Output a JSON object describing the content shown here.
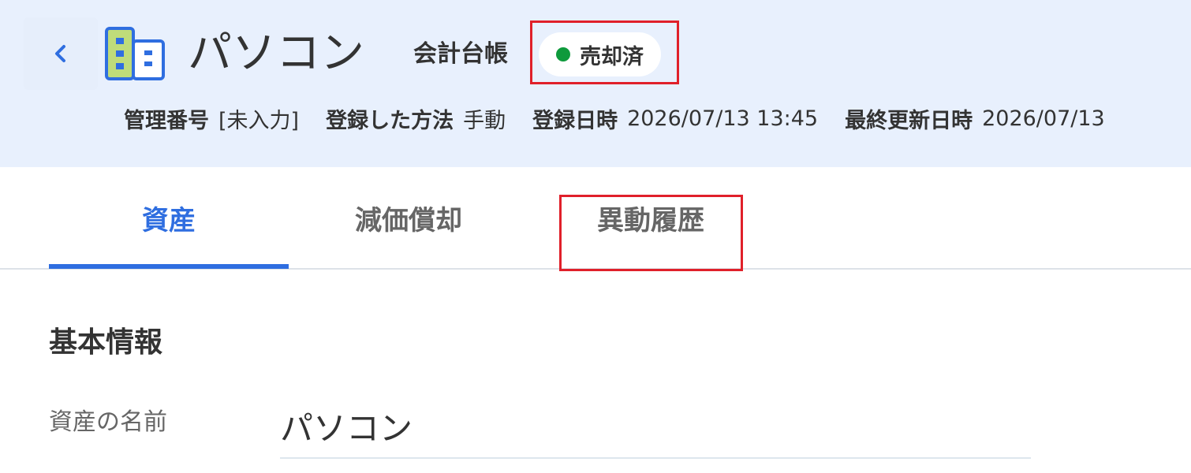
{
  "header": {
    "title": "パソコン",
    "ledger_label": "会計台帳",
    "status": {
      "label": "売却済",
      "dot_color": "#0e9a3c"
    },
    "meta": [
      {
        "key": "管理番号",
        "value": "[未入力]"
      },
      {
        "key": "登録した方法",
        "value": "手動"
      },
      {
        "key": "登録日時",
        "value": "2026/07/13 13:45"
      },
      {
        "key": "最終更新日時",
        "value": "2026/07/13"
      }
    ]
  },
  "tabs": [
    {
      "label": "資産",
      "active": true
    },
    {
      "label": "減価償却",
      "active": false
    },
    {
      "label": "異動履歴",
      "active": false
    }
  ],
  "basic_info": {
    "section_title": "基本情報",
    "asset_name_label": "資産の名前",
    "asset_name_value": "パソコン"
  },
  "colors": {
    "header_bg": "#e8f0fd",
    "accent": "#2f6ee0",
    "highlight": "#e0202a",
    "icon_green": "#bfdc7a",
    "icon_blue": "#2f6ee0"
  },
  "icons": {
    "back": "chevron-left-icon",
    "asset": "asset-building-icon"
  }
}
